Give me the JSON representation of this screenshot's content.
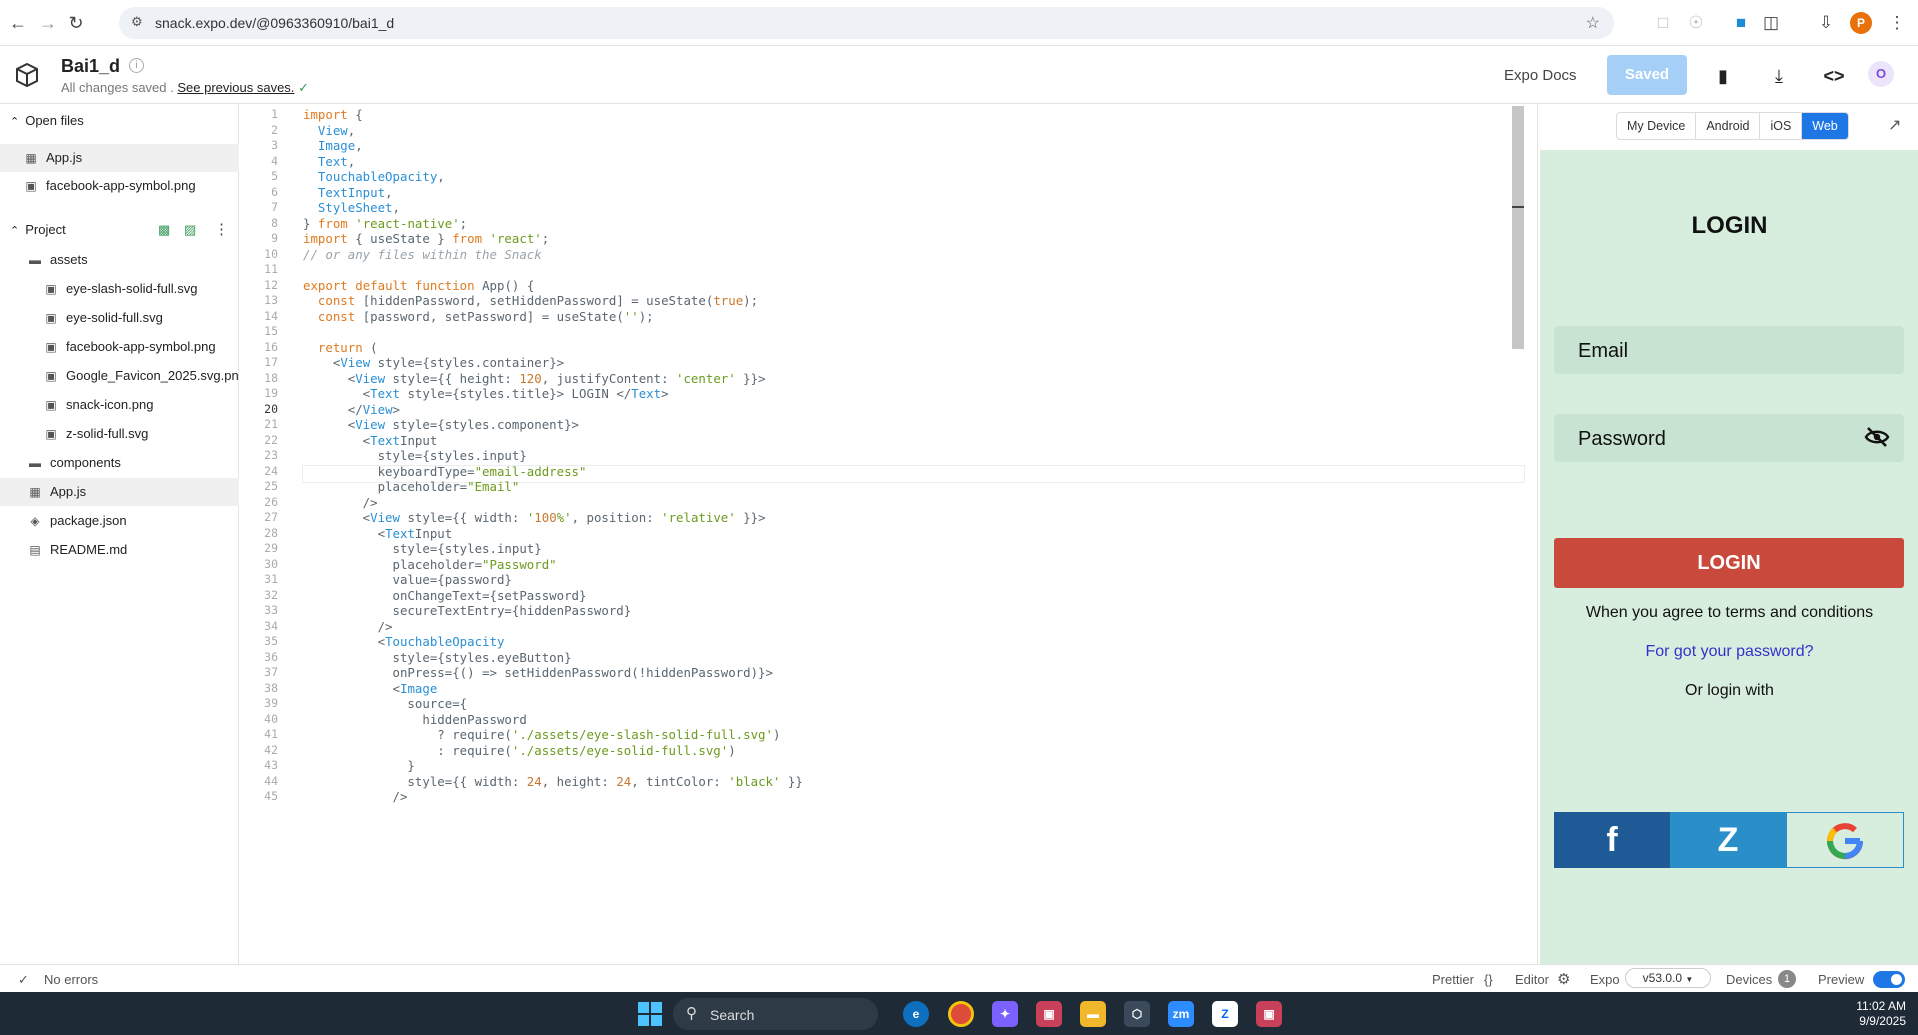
{
  "browser": {
    "url": "snack.expo.dev/@0963360910/bai1_d"
  },
  "header": {
    "project_name": "Bai1_d",
    "info_icon": "i",
    "status_text": "All changes saved .",
    "previous_link": "See previous saves.",
    "docs_label": "Expo Docs",
    "saved_label": "Saved",
    "avatar": "O"
  },
  "sidebar": {
    "open_files_label": "Open files",
    "open_files": [
      "App.js",
      "facebook-app-symbol.png"
    ],
    "project_label": "Project",
    "tree": [
      {
        "name": "assets",
        "type": "folder"
      },
      {
        "name": "eye-slash-solid-full.svg",
        "type": "image"
      },
      {
        "name": "eye-solid-full.svg",
        "type": "image"
      },
      {
        "name": "facebook-app-symbol.png",
        "type": "image"
      },
      {
        "name": "Google_Favicon_2025.svg.png",
        "type": "image"
      },
      {
        "name": "snack-icon.png",
        "type": "image"
      },
      {
        "name": "z-solid-full.svg",
        "type": "image"
      },
      {
        "name": "components",
        "type": "folder"
      },
      {
        "name": "App.js",
        "type": "js"
      },
      {
        "name": "package.json",
        "type": "pkg"
      },
      {
        "name": "README.md",
        "type": "doc"
      }
    ]
  },
  "editor": {
    "lines": [
      "import {",
      "  View,",
      "  Image,",
      "  Text,",
      "  TouchableOpacity,",
      "  TextInput,",
      "  StyleSheet,",
      "} from 'react-native';",
      "import { useState } from 'react';",
      "// or any files within the Snack",
      "",
      "export default function App() {",
      "  const [hiddenPassword, setHiddenPassword] = useState(true);",
      "  const [password, setPassword] = useState('');",
      "",
      "  return (",
      "    <View style={styles.container}>",
      "      <View style={{ height: 120, justifyContent: 'center' }}>",
      "        <Text style={styles.title}> LOGIN </Text>",
      "      </View>",
      "      <View style={styles.component}>",
      "        <TextInput",
      "          style={styles.input}",
      "          keyboardType=\"email-address\"",
      "          placeholder=\"Email\"",
      "        />",
      "        <View style={{ width: '100%', position: 'relative' }}>",
      "          <TextInput",
      "            style={styles.input}",
      "            placeholder=\"Password\"",
      "            value={password}",
      "            onChangeText={setPassword}",
      "            secureTextEntry={hiddenPassword}",
      "          />",
      "          <TouchableOpacity",
      "            style={styles.eyeButton}",
      "            onPress={() => setHiddenPassword(!hiddenPassword)}>",
      "            <Image",
      "              source={",
      "                hiddenPassword",
      "                  ? require('./assets/eye-slash-solid-full.svg')",
      "                  : require('./assets/eye-solid-full.svg')",
      "              }",
      "              style={{ width: 24, height: 24, tintColor: 'black' }}",
      "            />"
    ]
  },
  "preview": {
    "tabs": [
      "My Device",
      "Android",
      "iOS",
      "Web"
    ],
    "active_tab": "Web",
    "app": {
      "title": "LOGIN",
      "email_placeholder": "Email",
      "password_placeholder": "Password",
      "login_button": "LOGIN",
      "terms_text": "When you agree to terms and conditions",
      "forgot_text": "For got your password?",
      "or_login_text": "Or login with",
      "social": [
        "f",
        "Z",
        "G"
      ],
      "colors": {
        "background": "#d7eedf",
        "input": "#c8e3d1",
        "login": "#c94a3c",
        "facebook": "#1e5a96",
        "zalo": "#2a8fc8"
      }
    }
  },
  "statusbar": {
    "errors": "No errors",
    "prettier": "Prettier",
    "prettier_icon": "{}",
    "editor": "Editor",
    "expo": "Expo",
    "sdk": "v53.0.0",
    "devices": "Devices",
    "devices_count": "1",
    "preview": "Preview"
  },
  "taskbar": {
    "search": "Search",
    "time": "11:02 AM",
    "date": "9/9/2025"
  }
}
